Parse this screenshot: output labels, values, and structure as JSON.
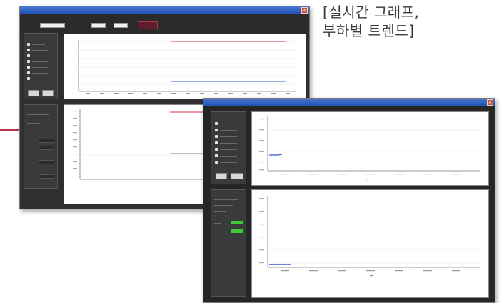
{
  "caption": {
    "line1": "[실시간 그래프,",
    "line2": "부하별 트렌드]"
  },
  "window1": {
    "title": "",
    "toolbar": {
      "button_label": ""
    },
    "left_panel": {
      "title": "",
      "items": [
        "",
        "",
        "",
        "",
        "",
        "",
        "",
        ""
      ],
      "buttons": [
        "",
        ""
      ]
    },
    "info_panel": {
      "title": ""
    },
    "accent_colors": {
      "series_red": "#d83040",
      "series_blue": "#3a5ad8",
      "series_gray": "#9a9a9a"
    }
  },
  "window2": {
    "title": "",
    "left_panel": {
      "title": "",
      "buttons": [
        "",
        ""
      ]
    },
    "info_panel": {
      "title": ""
    },
    "accent_colors": {
      "value_green": "#3acb3a",
      "series_blue": "#3a5ad8"
    }
  }
}
